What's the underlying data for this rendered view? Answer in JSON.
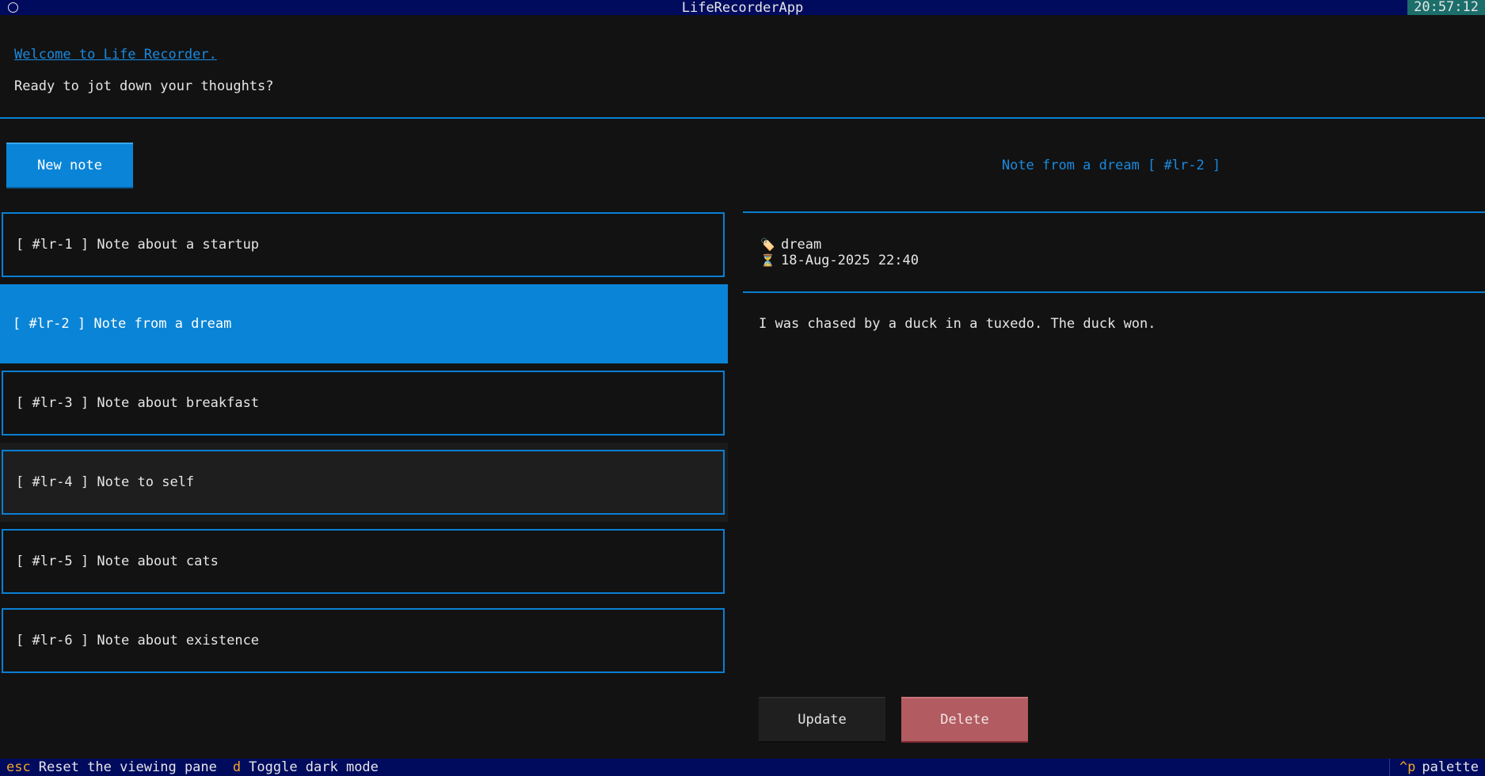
{
  "titlebar": {
    "title": "LifeRecorderApp",
    "clock": "20:57:12"
  },
  "header": {
    "welcome_link": "Welcome to Life Recorder.",
    "prompt": "Ready to jot down your thoughts?"
  },
  "toolbar": {
    "new_note_label": "New note"
  },
  "detail": {
    "title": "Note from a dream [ #lr-2 ]",
    "tag_icon": "tag-icon",
    "tag": "dream",
    "time_icon": "hourglass-icon",
    "timestamp": "18-Aug-2025 22:40",
    "body": "I was chased by a duck in a tuxedo. The duck won.",
    "update_label": "Update",
    "delete_label": "Delete"
  },
  "notes": [
    {
      "label": "[ #lr-1 ] Note about a startup"
    },
    {
      "label": "[ #lr-2 ] Note from a dream"
    },
    {
      "label": "[ #lr-3 ] Note about breakfast"
    },
    {
      "label": "[ #lr-4 ] Note to self"
    },
    {
      "label": "[ #lr-5 ] Note about cats"
    },
    {
      "label": "[ #lr-6 ] Note about existence"
    }
  ],
  "footer": {
    "bindings": [
      {
        "key": "esc",
        "desc": "Reset the viewing pane"
      },
      {
        "key": "d",
        "desc": "Toggle dark mode"
      }
    ],
    "palette_key": "^p",
    "palette_label": "palette"
  },
  "colors": {
    "accent": "#0a84d6",
    "background": "#121212",
    "title_bar": "#000b5e",
    "delete": "#b25b60",
    "key_highlight": "#f5a623"
  }
}
